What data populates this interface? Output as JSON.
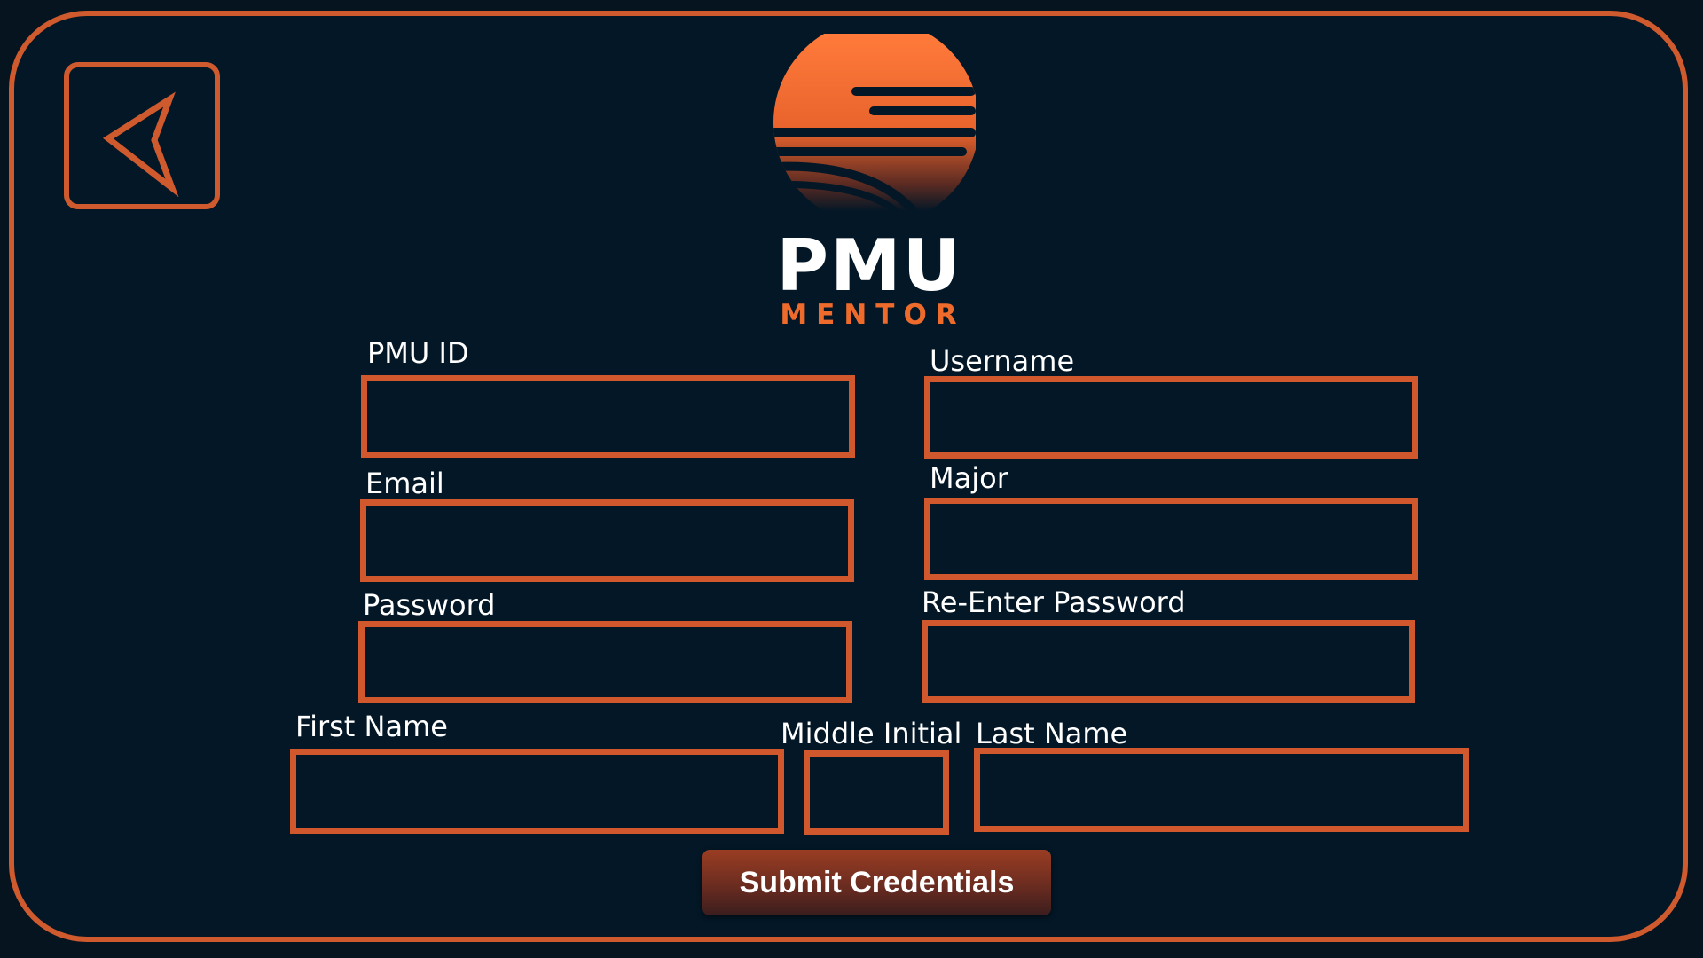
{
  "brand": {
    "title": "PMU",
    "subtitle": "MENTOR",
    "accent_color": "#cf5a2e",
    "background_color": "#031726"
  },
  "icons": {
    "back": "back-arrow-icon",
    "logo": "sunset-stripes-logo-icon"
  },
  "form": {
    "pmu_id": {
      "label": "PMU ID",
      "value": ""
    },
    "username": {
      "label": "Username",
      "value": ""
    },
    "email": {
      "label": "Email",
      "value": ""
    },
    "major": {
      "label": "Major",
      "value": ""
    },
    "password": {
      "label": "Password",
      "value": ""
    },
    "reenter_password": {
      "label": "Re-Enter Password",
      "value": ""
    },
    "first_name": {
      "label": "First Name",
      "value": ""
    },
    "middle_initial": {
      "label": "Middle Initial",
      "value": ""
    },
    "last_name": {
      "label": "Last Name",
      "value": ""
    }
  },
  "actions": {
    "submit_label": "Submit Credentials"
  }
}
